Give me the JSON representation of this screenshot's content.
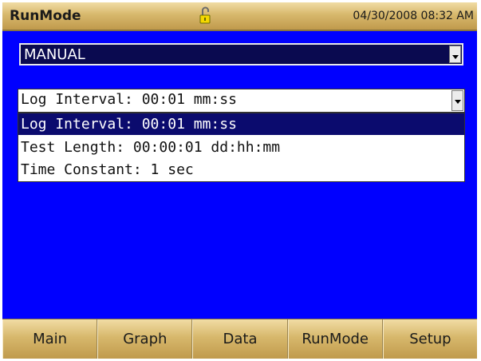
{
  "header": {
    "title": "RunMode",
    "datetime": "04/30/2008 08:32 AM",
    "lock_icon": "lock-open-icon"
  },
  "mode_select": {
    "value": "MANUAL"
  },
  "interval_select": {
    "value": "Log Interval: 00:01 mm:ss",
    "options": [
      "Log Interval: 00:01 mm:ss",
      "Test Length: 00:00:01 dd:hh:mm",
      "Time Constant: 1 sec"
    ]
  },
  "tabs": [
    {
      "label": "Main"
    },
    {
      "label": "Graph"
    },
    {
      "label": "Data"
    },
    {
      "label": "RunMode"
    },
    {
      "label": "Setup"
    }
  ],
  "colors": {
    "background": "#0000ff",
    "bar": "#d7b86c",
    "selection": "#0b0b6e"
  }
}
